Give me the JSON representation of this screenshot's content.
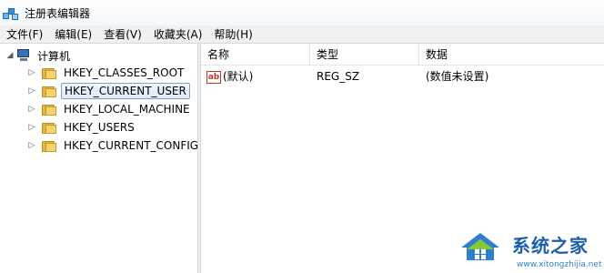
{
  "window": {
    "title": "注册表编辑器"
  },
  "menubar": {
    "items": [
      {
        "label": "文件(F)"
      },
      {
        "label": "编辑(E)"
      },
      {
        "label": "查看(V)"
      },
      {
        "label": "收藏夹(A)"
      },
      {
        "label": "帮助(H)"
      }
    ]
  },
  "tree": {
    "root": {
      "label": "计算机",
      "icon": "computer-icon",
      "expanded": true
    },
    "items": [
      {
        "label": "HKEY_CLASSES_ROOT",
        "icon": "folder-icon"
      },
      {
        "label": "HKEY_CURRENT_USER",
        "icon": "folder-icon",
        "selected": true
      },
      {
        "label": "HKEY_LOCAL_MACHINE",
        "icon": "folder-icon"
      },
      {
        "label": "HKEY_USERS",
        "icon": "folder-icon"
      },
      {
        "label": "HKEY_CURRENT_CONFIG",
        "icon": "folder-icon"
      }
    ]
  },
  "list": {
    "columns": [
      "名称",
      "类型",
      "数据"
    ],
    "rows": [
      {
        "name": "(默认)",
        "type": "REG_SZ",
        "data": "(数值未设置)",
        "icon": "string-value-icon"
      }
    ]
  },
  "watermark": {
    "text": "系统之家",
    "url": "www.xitongzhijia.net"
  },
  "colors": {
    "accent": "#1d5fa8",
    "selection_border": "#7da2ce"
  }
}
